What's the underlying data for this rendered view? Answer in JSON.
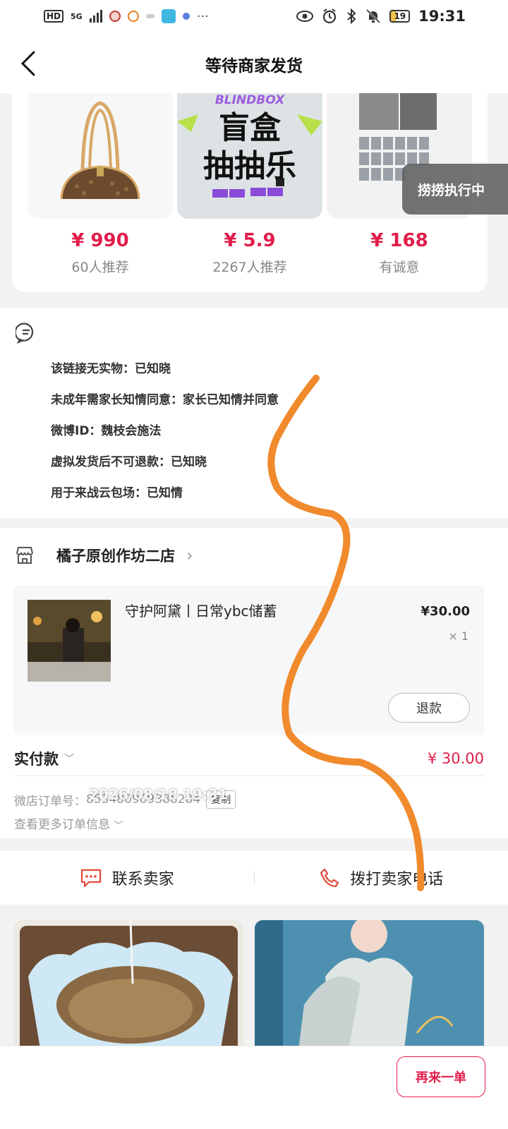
{
  "status_bar": {
    "hd": "HD",
    "network": "5G",
    "battery": "19",
    "time": "19:31"
  },
  "header": {
    "title": "等待商家发货"
  },
  "recommendations": [
    {
      "price": "¥ 990",
      "sub": "60人推荐",
      "image": "handbag-image"
    },
    {
      "price": "¥ 5.9",
      "sub": "2267人推荐",
      "image": "blindbox-image",
      "banner_top": "BLINDBOX",
      "banner_line1": "盲盒",
      "banner_line2": "抽抽乐"
    },
    {
      "price": "¥ 168",
      "sub": "有诚意",
      "image": "photocard-collage-image"
    }
  ],
  "floating_tag": "捞捞执行中",
  "notes": [
    "该链接无实物：已知晓",
    "未成年需家长知情同意：家长已知情并同意",
    "微博ID：魏枝会施法",
    "虚拟发货后不可退款：已知晓",
    "用于来战云包场：已知情"
  ],
  "shop": {
    "name": "橘子原创作坊二店"
  },
  "product": {
    "name": "守护阿黛丨日常ybc储蓄",
    "price": "¥30.00",
    "qty": "× 1",
    "refund_label": "退款"
  },
  "payment": {
    "label": "实付款",
    "amount": "¥ 30.00"
  },
  "order": {
    "number_label": "微店订单号：",
    "number": "853480909388284",
    "watermark": "2026/08/18 19:31",
    "copy_label": "复制",
    "more_label": "查看更多订单信息"
  },
  "contact": {
    "chat_label": "联系卖家",
    "call_label": "拨打卖家电话"
  },
  "bottom": {
    "reorder_label": "再来一单"
  },
  "colors": {
    "accent": "#e21d4a",
    "scribble": "#f08a2c"
  }
}
